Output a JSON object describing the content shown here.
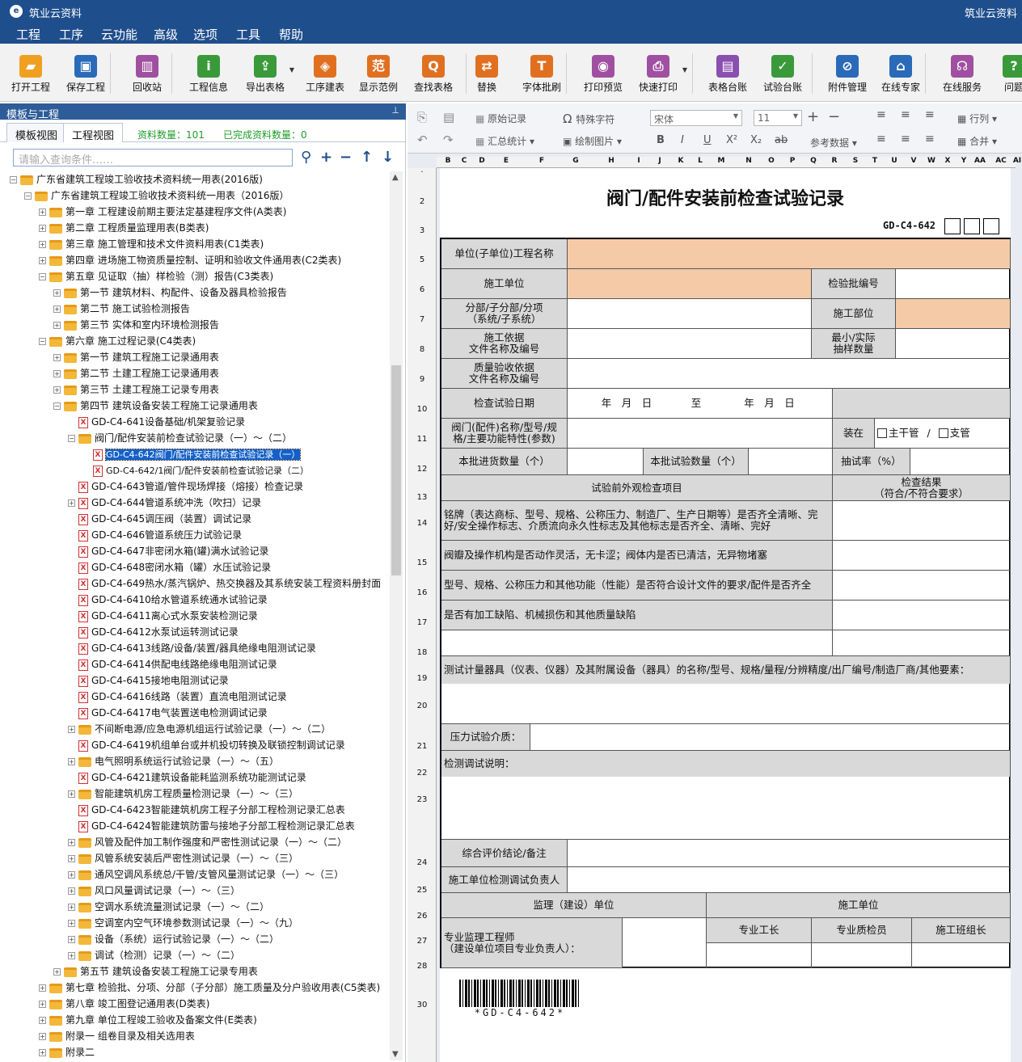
{
  "app": {
    "title": "筑业云资料",
    "title_right": "筑业云资料"
  },
  "menu": [
    "工程",
    "工序",
    "云功能",
    "高级",
    "选项",
    "工具",
    "帮助"
  ],
  "toolbar": [
    {
      "label": "打开工程",
      "icon": "folder-open-icon",
      "color": "#f0a020"
    },
    {
      "label": "保存工程",
      "icon": "save-icon",
      "color": "#2a6ab8"
    },
    {
      "label": "回收站",
      "icon": "trash-icon",
      "color": "#a050a0"
    },
    {
      "label": "工程信息",
      "icon": "info-icon",
      "color": "#3a9a3a"
    },
    {
      "label": "导出表格",
      "icon": "export-icon",
      "color": "#3a9a3a"
    },
    {
      "label": "工序建表",
      "icon": "layers-icon",
      "color": "#e07020"
    },
    {
      "label": "显示范例",
      "icon": "sample-icon",
      "color": "#e07020"
    },
    {
      "label": "查找表格",
      "icon": "search-table-icon",
      "color": "#e07020"
    },
    {
      "label": "替换",
      "icon": "replace-icon",
      "color": "#e07020"
    },
    {
      "label": "字体批刷",
      "icon": "font-brush-icon",
      "color": "#e07020"
    },
    {
      "label": "打印预览",
      "icon": "eye-icon",
      "color": "#a050a0"
    },
    {
      "label": "快速打印",
      "icon": "printer-icon",
      "color": "#a050a0"
    },
    {
      "label": "表格台账",
      "icon": "ledger-icon",
      "color": "#8a50b0"
    },
    {
      "label": "试验台账",
      "icon": "test-ledger-icon",
      "color": "#3a9a3a"
    },
    {
      "label": "附件管理",
      "icon": "paperclip-icon",
      "color": "#2a6ab8"
    },
    {
      "label": "在线专家",
      "icon": "expert-icon",
      "color": "#2a6ab8"
    },
    {
      "label": "在线服务",
      "icon": "headset-icon",
      "color": "#a050a0"
    },
    {
      "label": "问题",
      "icon": "help-icon",
      "color": "#3a9a3a"
    }
  ],
  "left": {
    "header": "模板与工程",
    "tabs": [
      "模板视图",
      "工程视图"
    ],
    "stat1": "资料数量：101",
    "stat2": "已完成资料数量：0",
    "search_placeholder": "请输入查询条件……",
    "tree": [
      {
        "d": 0,
        "t": "f",
        "e": "-",
        "label": "广东省建筑工程竣工验收技术资料统一用表(2016版)"
      },
      {
        "d": 1,
        "t": "f",
        "e": "-",
        "label": "广东省建筑工程竣工验收技术资料统一用表（2016版）"
      },
      {
        "d": 2,
        "t": "f",
        "e": "+",
        "label": "第一章 工程建设前期主要法定基建程序文件(A类表)"
      },
      {
        "d": 2,
        "t": "f",
        "e": "+",
        "label": "第二章 工程质量监理用表(B类表)"
      },
      {
        "d": 2,
        "t": "f",
        "e": "+",
        "label": "第三章 施工管理和技术文件资料用表(C1类表)"
      },
      {
        "d": 2,
        "t": "f",
        "e": "+",
        "label": "第四章 进场施工物资质量控制、证明和验收文件通用表(C2类表)"
      },
      {
        "d": 2,
        "t": "f",
        "e": "-",
        "label": "第五章  见证取（抽）样检验（测）报告(C3类表)"
      },
      {
        "d": 3,
        "t": "f",
        "e": "+",
        "label": "第一节 建筑材料、构配件、设备及器具检验报告"
      },
      {
        "d": 3,
        "t": "f",
        "e": "+",
        "label": "第二节 施工试验检测报告"
      },
      {
        "d": 3,
        "t": "f",
        "e": "+",
        "label": "第三节 实体和室内环境检测报告"
      },
      {
        "d": 2,
        "t": "f",
        "e": "-",
        "label": "第六章 施工过程记录(C4类表)"
      },
      {
        "d": 3,
        "t": "f",
        "e": "+",
        "label": "第一节 建筑工程施工记录通用表"
      },
      {
        "d": 3,
        "t": "f",
        "e": "+",
        "label": "第二节 土建工程施工记录通用表"
      },
      {
        "d": 3,
        "t": "f",
        "e": "+",
        "label": "第三节 土建工程施工记录专用表"
      },
      {
        "d": 3,
        "t": "f",
        "e": "-",
        "label": "第四节 建筑设备安装工程施工记录通用表"
      },
      {
        "d": 4,
        "t": "d",
        "e": "",
        "label": "GD-C4-641设备基础/机架复验记录"
      },
      {
        "d": 4,
        "t": "f",
        "e": "-",
        "label": "阀门/配件安装前检查试验记录（一）～（二）"
      },
      {
        "d": 5,
        "t": "d",
        "e": "",
        "label": "GD-C4-642阀门/配件安装前检查试验记录（一）",
        "sel": true
      },
      {
        "d": 5,
        "t": "d",
        "e": "",
        "label": "GD-C4-642/1阀门/配件安装前检查试验记录（二）"
      },
      {
        "d": 4,
        "t": "d",
        "e": "",
        "label": "GD-C4-643管道/管件现场焊接（熔接）检查记录"
      },
      {
        "d": 4,
        "t": "d",
        "e": "+",
        "label": "GD-C4-644管道系统冲洗（吹扫）记录"
      },
      {
        "d": 4,
        "t": "d",
        "e": "",
        "label": "GD-C4-645调压阀（装置）调试记录"
      },
      {
        "d": 4,
        "t": "d",
        "e": "",
        "label": "GD-C4-646管道系统压力试验记录"
      },
      {
        "d": 4,
        "t": "d",
        "e": "",
        "label": "GD-C4-647非密闭水箱(罐)满水试验记录"
      },
      {
        "d": 4,
        "t": "d",
        "e": "",
        "label": "GD-C4-648密闭水箱（罐）水压试验记录"
      },
      {
        "d": 4,
        "t": "d",
        "e": "",
        "label": "GD-C4-649热水/蒸汽锅炉、热交换器及其系统安装工程资料册封面"
      },
      {
        "d": 4,
        "t": "d",
        "e": "",
        "label": "GD-C4-6410给水管道系统通水试验记录"
      },
      {
        "d": 4,
        "t": "d",
        "e": "",
        "label": "GD-C4-6411离心式水泵安装检测记录"
      },
      {
        "d": 4,
        "t": "d",
        "e": "",
        "label": "GD-C4-6412水泵试运转测试记录"
      },
      {
        "d": 4,
        "t": "d",
        "e": "",
        "label": "GD-C4-6413线路/设备/装置/器具绝缘电阻测试记录"
      },
      {
        "d": 4,
        "t": "d",
        "e": "",
        "label": "GD-C4-6414供配电线路绝缘电阻测试记录"
      },
      {
        "d": 4,
        "t": "d",
        "e": "",
        "label": "GD-C4-6415接地电阻测试记录"
      },
      {
        "d": 4,
        "t": "d",
        "e": "",
        "label": "GD-C4-6416线路（装置）直流电阻测试记录"
      },
      {
        "d": 4,
        "t": "d",
        "e": "",
        "label": "GD-C4-6417电气装置送电检测调试记录"
      },
      {
        "d": 4,
        "t": "f",
        "e": "+",
        "label": "不间断电源/应急电源机组运行试验记录（一）～（二）"
      },
      {
        "d": 4,
        "t": "d",
        "e": "",
        "label": "GD-C4-6419机组单台或并机投切转换及联锁控制调试记录"
      },
      {
        "d": 4,
        "t": "f",
        "e": "+",
        "label": "电气照明系统运行试验记录（一）～（五）"
      },
      {
        "d": 4,
        "t": "d",
        "e": "",
        "label": "GD-C4-6421建筑设备能耗监测系统功能测试记录"
      },
      {
        "d": 4,
        "t": "f",
        "e": "+",
        "label": "智能建筑机房工程质量检测记录（一）～（三）"
      },
      {
        "d": 4,
        "t": "d",
        "e": "",
        "label": "GD-C4-6423智能建筑机房工程子分部工程检测记录汇总表"
      },
      {
        "d": 4,
        "t": "d",
        "e": "",
        "label": "GD-C4-6424智能建筑防雷与接地子分部工程检测记录汇总表"
      },
      {
        "d": 4,
        "t": "f",
        "e": "+",
        "label": "风管及配件加工制作强度和严密性测试记录（一）～（二）"
      },
      {
        "d": 4,
        "t": "f",
        "e": "+",
        "label": "风管系统安装后严密性测试记录（一）～（三）"
      },
      {
        "d": 4,
        "t": "f",
        "e": "+",
        "label": "通风空调风系统总/干管/支管风量测试记录（一）～（三）"
      },
      {
        "d": 4,
        "t": "f",
        "e": "+",
        "label": "风口风量调试记录（一）～（三）"
      },
      {
        "d": 4,
        "t": "f",
        "e": "+",
        "label": "空调水系统流量测试记录（一）～（二）"
      },
      {
        "d": 4,
        "t": "f",
        "e": "+",
        "label": "空调室内空气环境参数测试记录（一）～（九）"
      },
      {
        "d": 4,
        "t": "f",
        "e": "+",
        "label": "设备（系统）运行试验记录（一）～（二）"
      },
      {
        "d": 4,
        "t": "f",
        "e": "+",
        "label": "调试（检测）记录（一）～（二）"
      },
      {
        "d": 3,
        "t": "f",
        "e": "+",
        "label": "第五节 建筑设备安装工程施工记录专用表"
      },
      {
        "d": 2,
        "t": "f",
        "e": "+",
        "label": "第七章 检验批、分项、分部（子分部）施工质量及分户验收用表(C5类表)"
      },
      {
        "d": 2,
        "t": "f",
        "e": "+",
        "label": "第八章 竣工图登记通用表(D类表)"
      },
      {
        "d": 2,
        "t": "f",
        "e": "+",
        "label": "第九章 单位工程竣工验收及备案文件(E类表)"
      },
      {
        "d": 2,
        "t": "f",
        "e": "+",
        "label": "附录一 组卷目录及相关选用表"
      },
      {
        "d": 2,
        "t": "f",
        "e": "+",
        "label": "附录二"
      }
    ]
  },
  "format": {
    "original": "原始记录",
    "summary": "汇总统计",
    "special": "特殊字符",
    "draw": "绘制图片",
    "font": "宋体",
    "size": "11",
    "ref": "参考数据",
    "row": "行列",
    "merge": "合并",
    "bold": "B",
    "italic": "I",
    "underline": "U",
    "sup": "X²",
    "sub": "X₂",
    "strike": "ab"
  },
  "sheet": {
    "cols": [
      "B",
      "C",
      "D",
      "E",
      "F",
      "G",
      "H",
      "I",
      "J",
      "K",
      "L",
      "M",
      "N",
      "O",
      "P",
      "Q",
      "R",
      "S",
      "T",
      "U",
      "V",
      "W",
      "X",
      "Y",
      "AA",
      "AC",
      "AI"
    ],
    "rows": [
      "·",
      "2",
      "3",
      "5",
      "6",
      "7",
      "8",
      "9",
      "10",
      "11",
      "12",
      "13",
      "14",
      "15",
      "16",
      "17",
      "18",
      "19",
      "20",
      "21",
      "22",
      "23",
      "24",
      "25",
      "26",
      "27",
      "28",
      "30"
    ],
    "title": "阀门/配件安装前检查试验记录",
    "code": "GD-C4-642",
    "f": {
      "unit_proj": "单位(子单位)工程名称",
      "constr_unit": "施工单位",
      "batch_no": "检验批编号",
      "subdiv": "分部/子分部/分项\n（系统/子系统）",
      "constr_part": "施工部位",
      "basis": "施工依据\n文件名称及编号",
      "sample": "最小/实际\n抽样数量",
      "accept": "质量验收依据\n文件名称及编号",
      "date_label": "检查试验日期",
      "date_from": "年　月　日",
      "to": "至",
      "date_to": "年　月　日",
      "valve": "阀门(配件)名称/型号/规\n格/主要功能特性(参数)",
      "install": "装在",
      "main": "主干管",
      "slash": "/",
      "branch": "支管",
      "incoming": "本批进货数量（个）",
      "tested": "本批试验数量（个）",
      "rate": "抽试率（%）",
      "item_hdr": "试验前外观检查项目",
      "result_hdr": "检查结果\n（符合/不符合要求）",
      "i1": "铭牌（表达商标、型号、规格、公称压力、制造厂、生产日期等）是否齐全清晰、完好/安全操作标志、介质流向永久性标志及其他标志是否齐全、清晰、完好",
      "i2": "阀瓣及操作机构是否动作灵活，无卡涩；阀体内是否已清洁，无异物堵塞",
      "i3": "型号、规格、公称压力和其他功能（性能）是否符合设计文件的要求/配件是否齐全",
      "i4": "是否有加工缺陷、机械损伤和其他质量缺陷",
      "meter": "测试计量器具（仪表、仪器）及其附属设备（器具）的名称/型号、规格/量程/分辨精度/出厂编号/制造厂商/其他要素：",
      "medium": "压力试验介质：",
      "desc": "检测调试说明：",
      "concl": "综合评价结论/备注",
      "resp": "施工单位检测调试负责人",
      "sup_unit": "监理（建设）单位",
      "con_unit": "施工单位",
      "engineer": "专业监理工程师\n（建设单位项目专业负责人）：",
      "foreman": "专业工长",
      "qc": "专业质检员",
      "team": "施工班组长"
    },
    "barcode": "*GD-C4-642*"
  }
}
